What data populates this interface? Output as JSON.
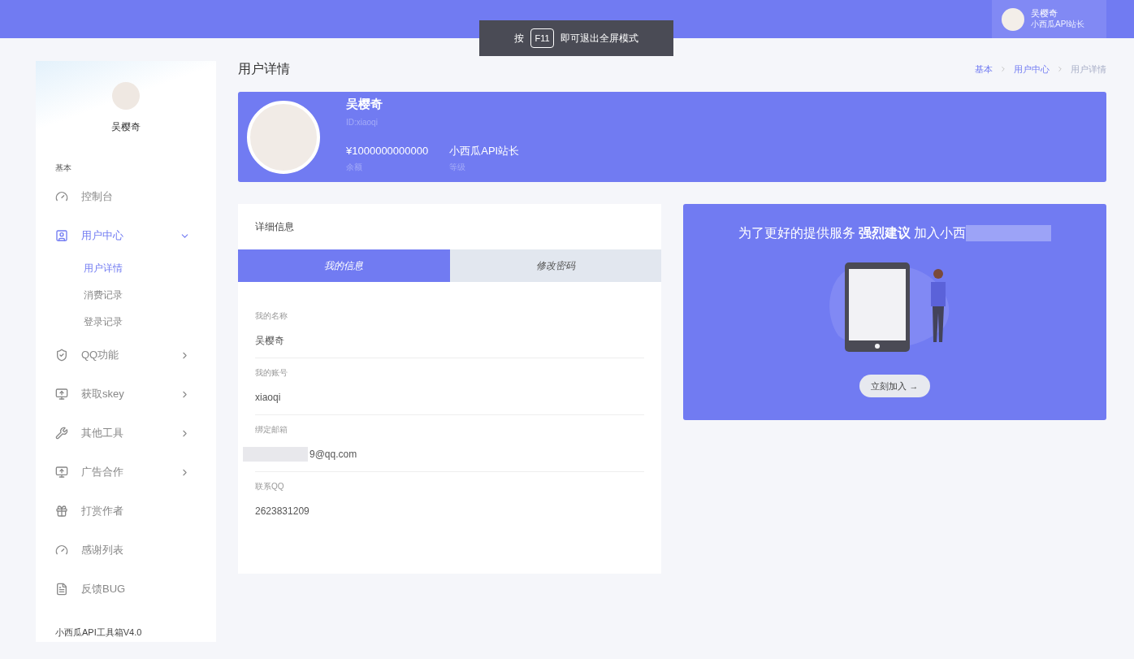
{
  "topbar": {
    "user_name": "吴樱奇",
    "user_role": "小西瓜API站长"
  },
  "toast": {
    "before": "按",
    "key": "F11",
    "after": "即可退出全屏模式"
  },
  "sidebar": {
    "user_name": "吴樱奇",
    "section": "基本",
    "footer": "小西瓜API工具箱V4.0",
    "items": [
      {
        "label": "控制台",
        "kind": "gauge",
        "selected": false
      },
      {
        "label": "用户中心",
        "kind": "user",
        "selected": true,
        "expanded": true,
        "children": [
          {
            "label": "用户详情",
            "selected": true
          },
          {
            "label": "消费记录",
            "selected": false
          },
          {
            "label": "登录记录",
            "selected": false
          }
        ]
      },
      {
        "label": "QQ功能",
        "kind": "shield",
        "selected": false,
        "expanded": false
      },
      {
        "label": "获取skey",
        "kind": "monitor",
        "selected": false,
        "expanded": false
      },
      {
        "label": "其他工具",
        "kind": "tool",
        "selected": false,
        "expanded": false
      },
      {
        "label": "广告合作",
        "kind": "monitor",
        "selected": false,
        "expanded": false
      },
      {
        "label": "打赏作者",
        "kind": "gift",
        "selected": false
      },
      {
        "label": "感谢列表",
        "kind": "gauge",
        "selected": false
      },
      {
        "label": "反馈BUG",
        "kind": "file",
        "selected": false
      }
    ]
  },
  "page": {
    "title": "用户详情",
    "breadcrumb": [
      {
        "label": "基本",
        "selected": false
      },
      {
        "label": "用户中心",
        "selected": false
      },
      {
        "label": "用户详情",
        "selected": true
      }
    ]
  },
  "profile": {
    "name": "吴樱奇",
    "id": "ID:xiaoqi",
    "stats": [
      {
        "value": "¥1000000000000",
        "label": "余额"
      },
      {
        "value": "小西瓜API站长",
        "label": "等级"
      }
    ]
  },
  "details": {
    "title": "详细信息",
    "tabs": [
      {
        "label": "我的信息",
        "selected": true
      },
      {
        "label": "修改密码",
        "selected": false
      }
    ],
    "fields": [
      {
        "label": "我的名称",
        "value": "吴樱奇",
        "redacted": false
      },
      {
        "label": "我的账号",
        "value": "xiaoqi",
        "redacted": false
      },
      {
        "label": "绑定邮箱",
        "value": "9@qq.com",
        "redacted": true
      },
      {
        "label": "联系QQ",
        "value": "2623831209",
        "redacted": false
      }
    ]
  },
  "promo": {
    "headline": "为了更好的提供服务 **强烈建议** 加入小西",
    "redacted": true,
    "button": "立刻加入 →"
  }
}
